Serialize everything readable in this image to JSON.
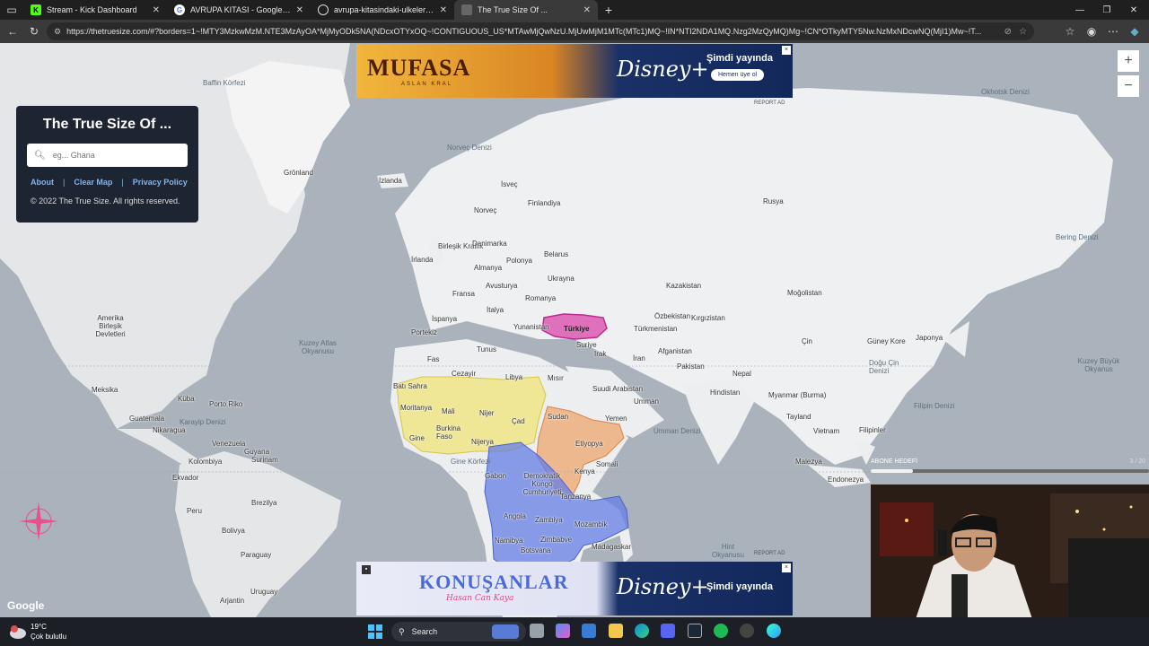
{
  "browser": {
    "tabs": [
      {
        "title": "Stream - Kick Dashboard",
        "icon": "kick-icon",
        "color": "#53fc18"
      },
      {
        "title": "AVRUPA KITASI - Google'da Ara",
        "icon": "google-icon",
        "color": "#ffffff"
      },
      {
        "title": "avrupa-kitasindaki-ulkeler-hangil",
        "icon": "globe-icon",
        "color": "#cccccc"
      },
      {
        "title": "The True Size Of ...",
        "icon": "page-icon",
        "color": "#888888"
      }
    ],
    "url": "https://thetruesize.com/#?borders=1~!MTY3MzkwMzM.NTE3MzAyOA*MjMyODk5NA(NDcxOTYxOQ~!CONTIGUOUS_US*MTAwMjQwNzU.MjUwMjM1MTc(MTc1)MQ~!IN*NTI2NDA1MQ.Nzg2MzQyMQ)Mg~!CN*OTkyMTY5Nw.NzMxNDcwNQ(MjI1)Mw~!T..."
  },
  "panel": {
    "title": "The True Size Of ...",
    "search_placeholder": "eg... Ghana",
    "links": [
      "About",
      "Clear Map",
      "Privacy Policy"
    ],
    "copyright": "© 2022 The True Size. All rights reserved."
  },
  "ads": {
    "top": {
      "brand": "MUFASA",
      "sub": "ASLAN KRAL",
      "service": "Disney+",
      "cta": "Şimdi yayında",
      "button": "Hemen üye ol"
    },
    "bottom": {
      "brand": "KONUŞANLAR",
      "sub": "Hasan Can Kaya",
      "service": "Disney+",
      "cta": "Şimdi yayında"
    },
    "report": "REPORT AD"
  },
  "map": {
    "attribution": "Google",
    "countries": [
      "Grönland",
      "İzlanda",
      "İsveç",
      "Finlandiya",
      "Norveç",
      "Rusya",
      "Birleşik Krallık",
      "Danimarka",
      "İrlanda",
      "Almanya",
      "Polonya",
      "Belarus",
      "Ukrayna",
      "Fransa",
      "Avusturya",
      "Romanya",
      "İspanya",
      "İtalya",
      "Portekiz",
      "Yunanistan",
      "Kazakistan",
      "Moğolistan",
      "Özbekistan",
      "Kırgızistan",
      "Türkmenistan",
      "Afganistan",
      "Suriye",
      "Irak",
      "İran",
      "Pakistan",
      "Nepal",
      "Çin",
      "Güney Kore",
      "Japonya",
      "Hindistan",
      "Myanmar (Burma)",
      "Tayland",
      "Vietnam",
      "Filipinler",
      "Malezya",
      "Endonezya",
      "Tunus",
      "Fas",
      "Cezayir",
      "Libya",
      "Mısır",
      "Suudi Arabistan",
      "Umman",
      "Yemen",
      "Batı Sahra",
      "Moritanya",
      "Mali",
      "Nijer",
      "Çad",
      "Sudan",
      "Etiyopya",
      "Somali",
      "Kenya",
      "Tanzanya",
      "Gine",
      "Burkina Faso",
      "Nijerya",
      "Gabon",
      "Demokratik Kongo Cumhuriyeti",
      "Angola",
      "Zambiya",
      "Mozambik",
      "Zimbabve",
      "Namibya",
      "Botsvana",
      "Madagaskar",
      "Amerika Birleşik Devletleri",
      "Meksika",
      "Küba",
      "Porto Riko",
      "Guatemala",
      "Nikaragua",
      "Venezuela",
      "Guyana",
      "Surinam",
      "Kolombiya",
      "Ekvador",
      "Peru",
      "Brezilya",
      "Bolivya",
      "Paraguay",
      "Uruguay",
      "Arjantin",
      "Türkiye"
    ],
    "seas": [
      "Baffin Körfezi",
      "Norveç Denizi",
      "Kuzey Atlas Okyanusu",
      "Karayip Denizi",
      "Umman Denizi",
      "Hint Okyanusu",
      "Gine Körfezi",
      "Okhotsk Denizi",
      "Bering Denizi",
      "Doğu Çin Denizi",
      "Filipin Denizi",
      "Kuzey Büyük Okyanus"
    ]
  },
  "overlay": {
    "goal_label": "ABONE HEDEFİ",
    "goal_count": "3 / 20",
    "goal_progress": 0.15
  },
  "taskbar": {
    "temp": "19°C",
    "weather": "Çok bulutlu",
    "search": "Search"
  }
}
